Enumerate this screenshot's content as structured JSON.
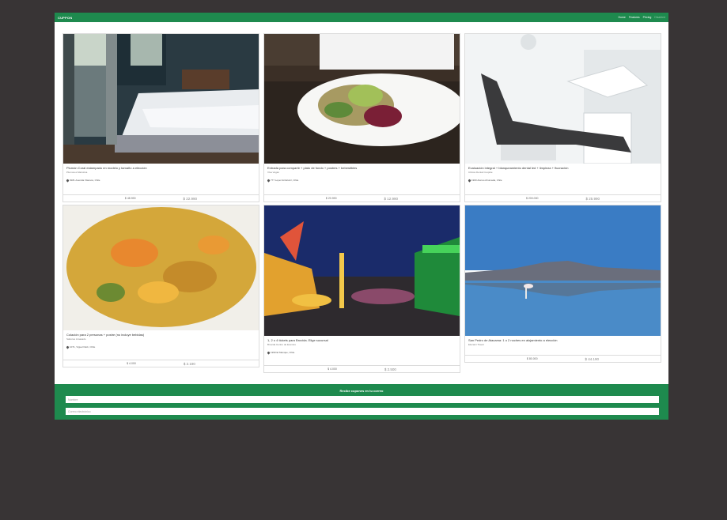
{
  "nav": {
    "brand": "CUPPON",
    "links": [
      "Home",
      "Features",
      "Pricing",
      "Disabled"
    ]
  },
  "cards": [
    {
      "title": "Plumón Coral estampado en modelo y tamaño a elección",
      "company": "Plumones Mariolina",
      "address": "8181 Avenida Vitacura, Chile",
      "old_price": "$ 48.990",
      "new_price": "$ 22.990",
      "image": "bedroom"
    },
    {
      "title": "Entrada para compartir + plato de fondo + postres + bebestibles",
      "company": "Viva Vegan",
      "address": "777 Lopez Errázuriz, Chile",
      "old_price": "$ 20.990",
      "new_price": "$ 12.990",
      "image": "salad"
    },
    {
      "title": "Evaluación integral + blanqueamiento dental led + limpieza + fluoración",
      "company": "Clínica Dental Cuspide",
      "address": "1900 Alonso Ahumada, Chile",
      "old_price": "$ 200.000",
      "new_price": "$ 25.990",
      "image": "dental"
    },
    {
      "title": "Colación para 2 personas + postre (no incluye bebidas)",
      "company": "Sabores Amasado",
      "address": "1071, Viguel Dark, Chile",
      "old_price": "$ 4.000",
      "new_price": "$ 2.190",
      "image": "food"
    },
    {
      "title": "1, 2 o 4 tickets para Bruvida. Elige sucursal",
      "company": "Bruvida Centro de Eventos",
      "address": "1990 El Manque, Chile",
      "old_price": "$ 4.000",
      "new_price": "$ 2.500",
      "image": "carnival"
    },
    {
      "title": "San Pedro de Atacama: 1 o 2 noches en alojamiento a elección",
      "company": "Elucami Travel",
      "address": "",
      "old_price": "$ 80.000",
      "new_price": "$ 44.190",
      "image": "atacama"
    }
  ],
  "footer": {
    "title": "Recibe cupones en tu correo",
    "name_placeholder": "Nombre",
    "email_placeholder": "Correo electrónico"
  },
  "colors": {
    "brand": "#1e8a4e",
    "background": "#383435"
  }
}
